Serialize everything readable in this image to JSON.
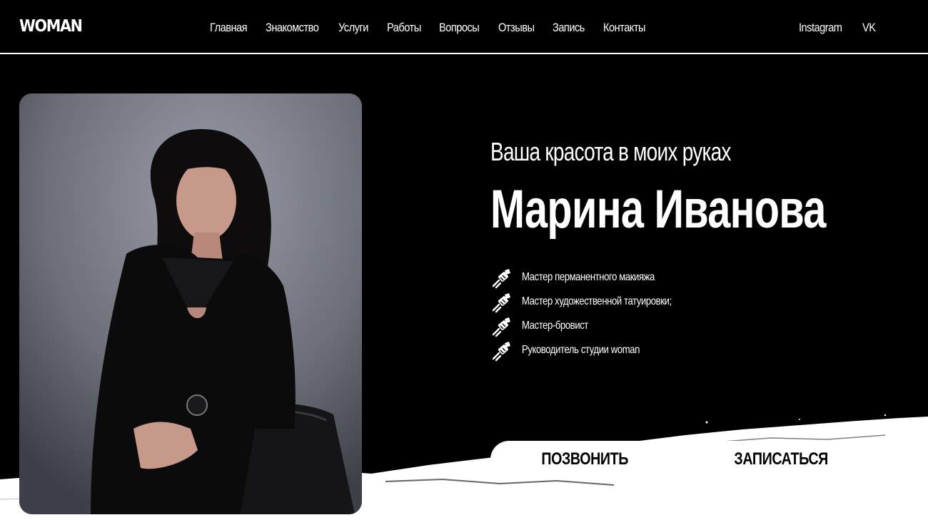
{
  "header": {
    "logo": "WOMAN",
    "nav": [
      "Главная",
      "Знакомство",
      "Услуги",
      "Работы",
      "Вопросы",
      "Отзывы",
      "Запись",
      "Контакты"
    ],
    "social": [
      "Instagram",
      "VK"
    ]
  },
  "hero": {
    "subtitle": "Ваша красота в моих руках",
    "name": "Марина Иванова",
    "features": [
      "Мастер перманентного макияжа",
      "Мастер художественной татуировки;",
      "Мастер-бровист",
      "Руководитель студии woman"
    ],
    "feature_icon": "tattoo-machine-icon",
    "buttons": {
      "call": "ПОЗВОНИТЬ",
      "book": "ЗАПИСАТЬСЯ"
    }
  },
  "colors": {
    "background": "#000000",
    "text": "#ffffff",
    "button_bg": "#ffffff",
    "button_text": "#000000"
  }
}
